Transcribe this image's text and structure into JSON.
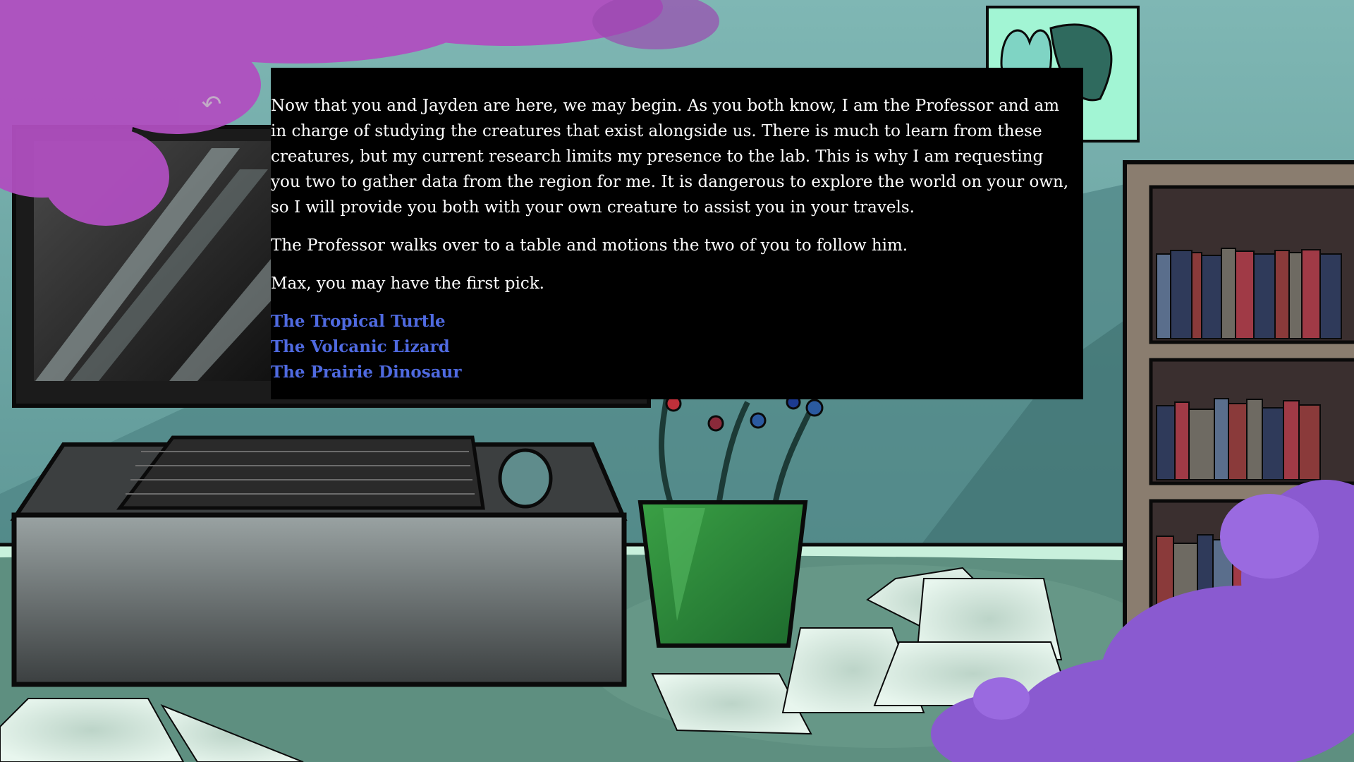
{
  "story": {
    "paragraphs": [
      "Now that you and Jayden are here, we may begin. As you both know, I am the Professor and am in charge of studying the creatures that exist alongside us. There is much to learn from these creatures, but my current research limits my presence to the lab. This is why I am requesting you two to gather data from the region for me. It is dangerous to explore the world on your own, so I will provide you both with your own creature to assist you in your travels.",
      "The Professor walks over to a table and motions the two of you to follow him.",
      "Max, you may have the first pick."
    ],
    "choices": [
      "The Tropical Turtle",
      "The Volcanic Lizard",
      "The Prairie Dinosaur"
    ]
  },
  "ui": {
    "undo_icon": "↶",
    "undo_icon_name": "undo-arrow-icon"
  },
  "colors": {
    "passage_bg": "#000000",
    "passage_text": "#ffffff",
    "link": "#4f6ae0",
    "wall": "#6fa8a8",
    "floor": "#5e8f80",
    "tree_blossom": "#b04fc0",
    "purple_flowers": "#8a5ad0"
  }
}
